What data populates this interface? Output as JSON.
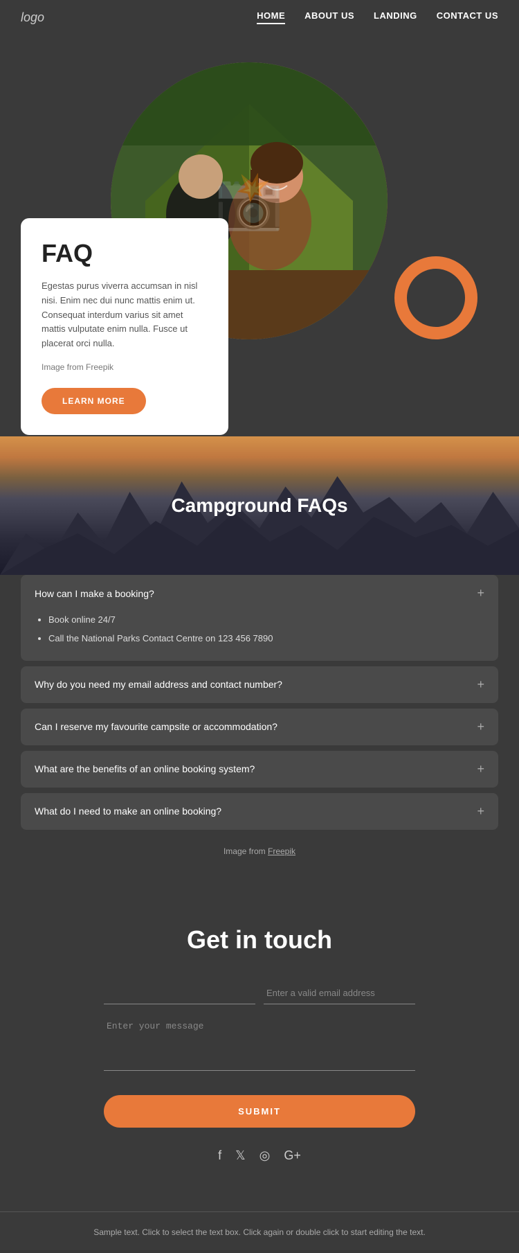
{
  "nav": {
    "logo": "logo",
    "links": [
      {
        "label": "HOME",
        "active": false
      },
      {
        "label": "ABOUT US",
        "active": false
      },
      {
        "label": "LANDING",
        "active": false
      },
      {
        "label": "CONTACT US",
        "active": false
      }
    ]
  },
  "hero": {
    "faq_title": "FAQ",
    "faq_description": "Egestas purus viverra accumsan in nisl nisi. Enim nec dui nunc mattis enim ut. Consequat interdum varius sit amet mattis vulputate enim nulla. Fusce ut placerat orci nulla.",
    "image_credit_text": "Image from Freepik",
    "learn_more_label": "LEARN MORE"
  },
  "faq_section": {
    "title": "Campground FAQs",
    "items": [
      {
        "question": "How can I make a booking?",
        "expanded": true,
        "answer_bullets": [
          "Book online 24/7",
          "Call the National Parks Contact Centre on 123 456 7890"
        ]
      },
      {
        "question": "Why do you need my email address and contact number?",
        "expanded": false
      },
      {
        "question": "Can I reserve my favourite campsite or accommodation?",
        "expanded": false
      },
      {
        "question": "What are the benefits of an online booking system?",
        "expanded": false
      },
      {
        "question": "What do I need to make an online booking?",
        "expanded": false
      }
    ],
    "image_credit": "Image from Freepik"
  },
  "contact": {
    "title": "Get in touch",
    "name_placeholder": "",
    "email_placeholder": "Enter a valid email address",
    "message_placeholder": "Enter your message",
    "submit_label": "SUBMIT"
  },
  "social": {
    "icons": [
      "f",
      "𝕏",
      "◎",
      "G+"
    ]
  },
  "footer": {
    "text": "Sample text. Click to select the text box. Click again or double click to start editing the text."
  }
}
